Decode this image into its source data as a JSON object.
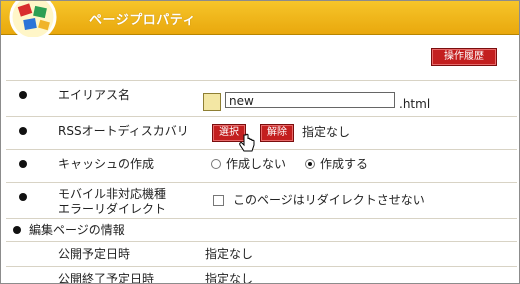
{
  "header": {
    "title": "ページプロパティ"
  },
  "history_button": {
    "label": "操作履歴"
  },
  "alias": {
    "label": "エイリアス名",
    "value": "new",
    "suffix": ".html"
  },
  "rss": {
    "label": "RSSオートディスカバリ",
    "select_label": "選択",
    "clear_label": "解除",
    "value": "指定なし"
  },
  "cache": {
    "label": "キャッシュの作成",
    "options": [
      "作成しない",
      "作成する"
    ],
    "selected": "作成する"
  },
  "mobile": {
    "label_line1": "モバイル非対応機種",
    "label_line2": "エラーリダイレクト",
    "checkbox_label": "このページはリダイレクトさせない"
  },
  "section": {
    "title": "編集ページの情報"
  },
  "publish_start": {
    "label": "公開予定日時",
    "value": "指定なし"
  },
  "publish_end": {
    "label": "公開終了予定日時",
    "value": "指定なし"
  }
}
